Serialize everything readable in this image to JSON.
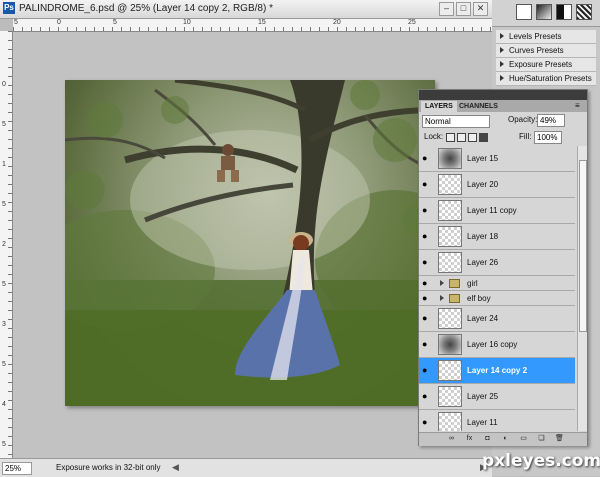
{
  "app": {
    "badge": "Ps"
  },
  "document": {
    "title": "PALINDROME_6.psd @ 25% (Layer 14 copy 2, RGB/8) *",
    "window_buttons": [
      "–",
      "□",
      "✕"
    ]
  },
  "rulers": {
    "top_labels": [
      "5",
      "0",
      "5",
      "10",
      "15",
      "20",
      "25"
    ],
    "left_labels": [
      "0",
      "5",
      "1",
      "5",
      "2",
      "5",
      "3",
      "5",
      "4",
      "5"
    ]
  },
  "status": {
    "zoom": "25%",
    "text": "Exposure works in 32-bit only"
  },
  "adjustment_presets": [
    "Levels Presets",
    "Curves Presets",
    "Exposure Presets",
    "Hue/Saturation Presets"
  ],
  "layers_panel": {
    "tabs": [
      "LAYERS",
      "CHANNELS"
    ],
    "blend_mode": "Normal",
    "opacity_label": "Opacity:",
    "opacity_value": "49%",
    "lock_label": "Lock:",
    "fill_label": "Fill:",
    "fill_value": "100%",
    "layers": [
      {
        "name": "Layer 15",
        "kind": "layer",
        "thumb": "dark",
        "selected": false
      },
      {
        "name": "Layer 20",
        "kind": "layer",
        "thumb": "transparent",
        "selected": false
      },
      {
        "name": "Layer 11 copy",
        "kind": "layer",
        "thumb": "transparent",
        "selected": false
      },
      {
        "name": "Layer 18",
        "kind": "layer",
        "thumb": "transparent",
        "selected": false
      },
      {
        "name": "Layer 26",
        "kind": "layer",
        "thumb": "transparent",
        "selected": false
      },
      {
        "name": "girl",
        "kind": "group",
        "selected": false
      },
      {
        "name": "elf boy",
        "kind": "group",
        "selected": false
      },
      {
        "name": "Layer 24",
        "kind": "layer",
        "thumb": "transparent",
        "selected": false
      },
      {
        "name": "Layer 16 copy",
        "kind": "layer",
        "thumb": "dark",
        "selected": false
      },
      {
        "name": "Layer 14 copy 2",
        "kind": "layer",
        "thumb": "transparent",
        "selected": true
      },
      {
        "name": "Layer 25",
        "kind": "layer",
        "thumb": "transparent",
        "selected": false
      },
      {
        "name": "Layer 11",
        "kind": "layer",
        "thumb": "transparent",
        "selected": false
      }
    ],
    "footer_icons": [
      "link-icon",
      "fx-icon",
      "mask-icon",
      "adjustment-icon",
      "group-icon",
      "new-layer-icon",
      "trash-icon"
    ]
  },
  "watermark": "pxleyes.com"
}
